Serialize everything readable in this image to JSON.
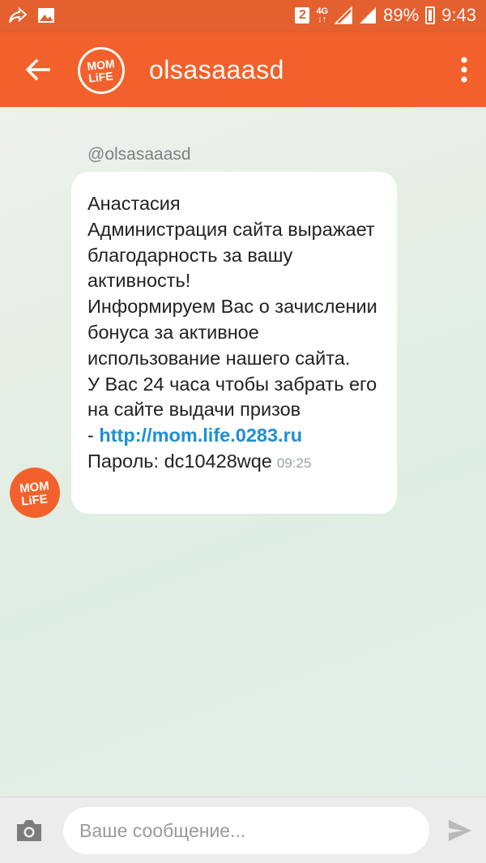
{
  "status_bar": {
    "sim_slot": "2",
    "network": "4G",
    "battery": "89%",
    "time": "9:43"
  },
  "app_bar": {
    "title": "olsasaaasd",
    "logo_text_top": "MOM",
    "logo_text_bottom": "LiFE"
  },
  "chat": {
    "sender_handle": "@olsasaaasd",
    "message": {
      "text": "Анастасия\nАдминистрация сайта выражает благодарность за вашу активность!\nИнформируем Вас о зачислении бонуса за активное использование нашего сайта.\nУ Вас 24 часа чтобы забрать его на сайте выдачи призов\n-  ",
      "link": "http://mom.life.0283.ru",
      "password_line": "Пароль: dc10428wqe",
      "time": "09:25"
    }
  },
  "input_bar": {
    "placeholder": "Ваше сообщение...",
    "value": ""
  },
  "colors": {
    "brand_orange": "#f2612b",
    "link_blue": "#1d8fd4"
  },
  "icons": [
    "share-icon",
    "image-icon",
    "sim-2-icon",
    "signal-icon",
    "battery-icon",
    "back-arrow-icon",
    "more-vert-icon",
    "camera-icon",
    "send-icon"
  ]
}
